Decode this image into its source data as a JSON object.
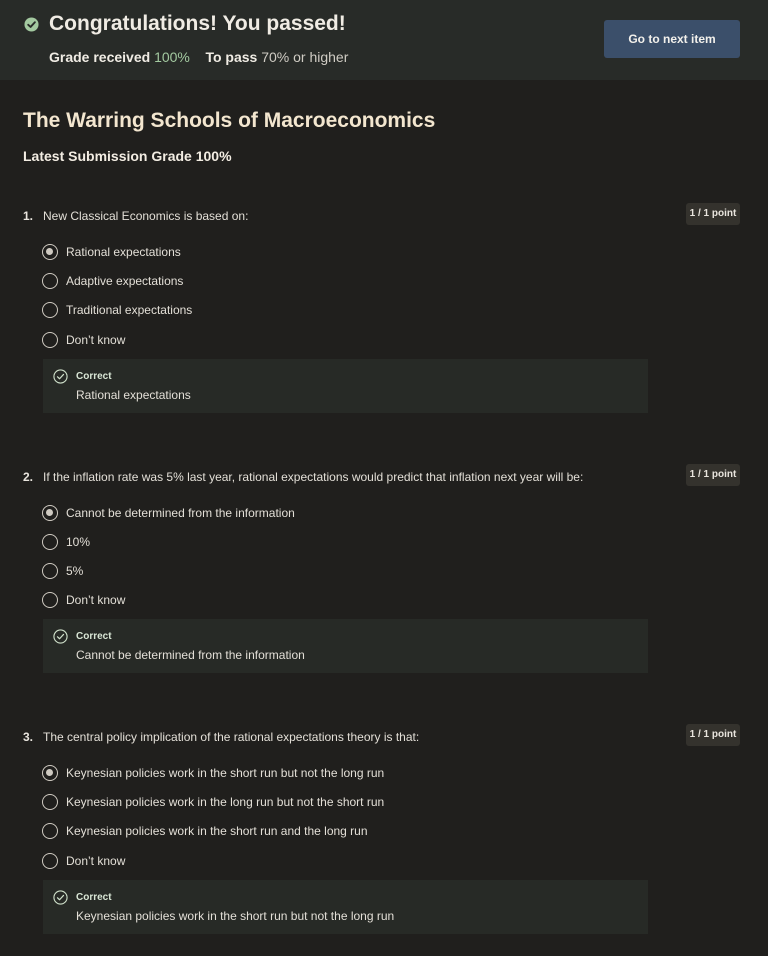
{
  "banner": {
    "title": "Congratulations! You passed!",
    "grade_label": "Grade received",
    "grade_value": "100%",
    "pass_label": "To pass",
    "pass_value": "70% or higher",
    "next_button": "Go to next item",
    "icon": "check-circle-icon"
  },
  "quiz": {
    "title": "The Warring Schools of Macroeconomics",
    "latest_grade": "Latest Submission Grade 100%"
  },
  "questions": [
    {
      "number": "1.",
      "text": "New Classical Economics is based on:",
      "points": "1 / 1 point",
      "options": [
        "Rational expectations",
        "Adaptive expectations",
        "Traditional expectations",
        "Don’t know"
      ],
      "selected_index": 0,
      "feedback_title": "Correct",
      "feedback_answer": "Rational expectations"
    },
    {
      "number": "2.",
      "text": "If the inflation rate was 5% last year, rational expectations would predict that inflation next year will be:",
      "points": "1 / 1 point",
      "options": [
        "Cannot be determined from the information",
        "10%",
        "5%",
        "Don’t know"
      ],
      "selected_index": 0,
      "feedback_title": "Correct",
      "feedback_answer": "Cannot be determined from the information"
    },
    {
      "number": "3.",
      "text": "The central policy implication of the rational expectations theory is that:",
      "points": "1 / 1 point",
      "options": [
        "Keynesian policies work in the short run but not the long run",
        "Keynesian policies work in the long run but not the short run",
        "Keynesian policies work in the short run and the long run",
        "Don’t know"
      ],
      "selected_index": 0,
      "feedback_title": "Correct",
      "feedback_answer": "Keynesian policies work in the short run but not the long run"
    }
  ],
  "colors": {
    "background": "#201f1d",
    "banner": "#282b28",
    "button": "#3b4f6a",
    "grade_green": "#a3c9a0",
    "title": "#f3e6cf"
  }
}
